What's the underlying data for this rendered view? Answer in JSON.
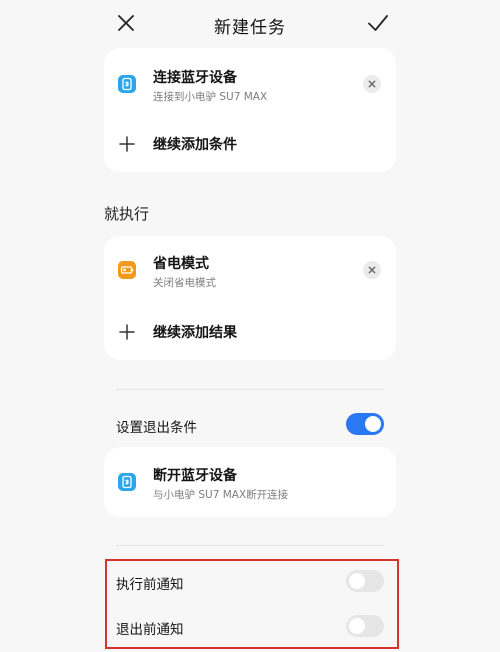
{
  "header": {
    "title": "新建任务",
    "close_icon": "close-icon",
    "confirm_icon": "check-icon"
  },
  "conditions": {
    "items": [
      {
        "title": "连接蓝牙设备",
        "subtitle": "连接到小电驴 SU7 MAX",
        "icon": "bluetooth-icon",
        "icon_color": "#2aa6ee"
      }
    ],
    "add_label": "继续添加条件"
  },
  "actions_section": {
    "label": "就执行",
    "items": [
      {
        "title": "省电模式",
        "subtitle": "关闭省电模式",
        "icon": "battery-icon",
        "icon_color": "#f39a1d"
      }
    ],
    "add_label": "继续添加结果"
  },
  "exit_condition": {
    "label": "设置退出条件",
    "enabled": true,
    "item": {
      "title": "断开蓝牙设备",
      "subtitle": "与小电驴 SU7 MAX断开连接",
      "icon": "bluetooth-icon",
      "icon_color": "#2aa6ee"
    }
  },
  "notifications": [
    {
      "label": "执行前通知",
      "enabled": false
    },
    {
      "label": "退出前通知",
      "enabled": false
    }
  ],
  "colors": {
    "accent": "#2a78f2",
    "highlight": "#d9322f"
  }
}
